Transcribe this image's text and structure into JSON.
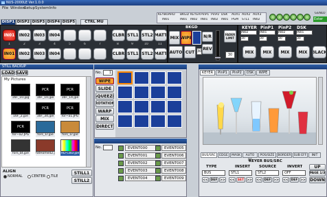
{
  "window": {
    "title": "NUS-2000LE Ver.1.0.0"
  },
  "menu": [
    "File",
    "Window",
    "Setup",
    "SystemInfo"
  ],
  "top_status": [
    {
      "label": "KEYBOARD",
      "value": "IN01"
    },
    {
      "label": "BKGD",
      "value": "IN01"
    },
    {
      "label": "KEYER",
      "value": "IN02"
    },
    {
      "label": "PinP1",
      "value": "IN01"
    },
    {
      "label": "PinP2",
      "value": "IN02"
    },
    {
      "label": "DSK",
      "value": "IN01"
    },
    {
      "label": "AUX1",
      "value": "PGM"
    },
    {
      "label": "AUX2",
      "value": "STL1"
    },
    {
      "label": "AUX3",
      "value": "IN02"
    }
  ],
  "genlock": {
    "label": "GENLO",
    "value": "Exter"
  },
  "tabs": [
    "DISP1",
    "DISP2",
    "DISP3",
    "DISP4",
    "DISP5",
    "CTRL MU"
  ],
  "xpoint": {
    "row1": [
      "IN01",
      "IN02",
      "IN03",
      "IN04",
      "",
      "",
      "",
      "CLBR",
      "STL1",
      "STL2",
      "MATT"
    ],
    "numbers": [
      "1",
      "2",
      "3",
      "4",
      "5",
      "6",
      "7",
      "8",
      "9",
      "10",
      "11",
      "12"
    ],
    "row2": [
      "IN01",
      "IN02",
      "IN03",
      "IN04",
      "",
      "",
      "",
      "CLBR",
      "STL1",
      "STL2",
      "MATT"
    ]
  },
  "bkgd": {
    "title": "BKGD",
    "mix": "MIX",
    "wipe": "WIPE",
    "nr": "N/R",
    "rev": "REV",
    "auto": "AUTO",
    "cut": "CUT",
    "rate": "30",
    "fader": "FADER LIMIT",
    "rate2": "30"
  },
  "keyer_panel": {
    "headers": [
      "KEYER",
      "PinP1",
      "PinP2",
      "DSK"
    ],
    "selects": [
      "IN02",
      "IN01",
      "IN02",
      "IN01"
    ],
    "rates": [
      "30",
      "30",
      "30",
      "30"
    ],
    "mix": "MIX",
    "black": "BLACK"
  },
  "still_backup": {
    "title": "STILL BACKUP",
    "load": "LOAD",
    "save": "SAVE",
    "folder": "My Pictures",
    "thumbs": [
      {
        "img": "",
        "cap": "16F_10.jpg"
      },
      {
        "img": "PCR",
        "cap": "16F_10.jpe"
      },
      {
        "img": "PCR",
        "cap": "16F_14.jpe"
      },
      {
        "img": "",
        "cap": "16F_2.jpe"
      },
      {
        "img": "PCR",
        "cap": "16F_34.jpe"
      },
      {
        "img": "PCR",
        "cap": "for~a1.JPG"
      },
      {
        "img": "PCR",
        "cap": "for~a2.JPG"
      },
      {
        "img": "",
        "cap": "fors_1r.jpe"
      },
      {
        "img": "",
        "cap": "fors_1r.jpe"
      },
      {
        "img": "",
        "cap": "fors_bt.jpe"
      },
      {
        "img": "",
        "cap": "fotHome42.jpe"
      },
      {
        "img": "",
        "cap": "HD-CBD.jpe"
      }
    ],
    "align": "ALIGN",
    "align_opts": [
      "NORMAL",
      "CENTER",
      "TILE"
    ],
    "still1": "STILL1",
    "still2": "STILL2"
  },
  "wipe_panel": {
    "no_label": "No.",
    "no_value": "1",
    "buttons": [
      "WIPE",
      "SLIDE",
      "SQUEEZE",
      "ROTATION",
      "WARP",
      "MIX",
      "DIRECT"
    ]
  },
  "event_panel": {
    "no_label": "No.",
    "col1": [
      "EVENT000",
      "EVENT001",
      "EVENT002",
      "EVENT003",
      "EVENT004"
    ],
    "col2": [
      "EVENT005",
      "EVENT006",
      "EVENT007",
      "EVENT008",
      "EVENT009"
    ]
  },
  "keyer_detail": {
    "tabs": [
      "KEYER",
      "PinP1",
      "PinP2",
      "DSK",
      "WIPE"
    ],
    "subtabs": [
      "BUS/SRC",
      "EDGE",
      "MASK",
      "AUTO DE",
      "POS/SIZE",
      "BORDER",
      "SUB EFF",
      "INIT"
    ],
    "group_title": "KEYER BUS/SRC",
    "type": "TYPE",
    "insert": "INSERT",
    "source": "SOURCE",
    "invert": "INVERT",
    "up": "UP",
    "bus": "BUS",
    "stl": "STL1",
    "stl2": "STL2",
    "off": "OFF",
    "page": "PAGE 1/3",
    "def": "DEF",
    "set": "SET",
    "down": "DOWN",
    "prev": "<<",
    "next": ">>"
  }
}
